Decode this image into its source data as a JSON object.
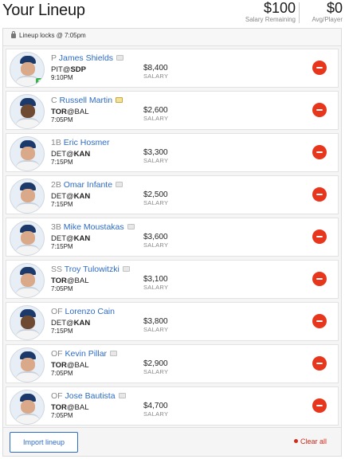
{
  "header": {
    "title": "Your Lineup",
    "salary_remaining": "$100",
    "salary_remaining_label": "Salary Remaining",
    "avg_player": "$0",
    "avg_player_label": "Avg/Player"
  },
  "lock_text": "Lineup locks @ 7:05pm",
  "salary_label": "SALARY",
  "players": [
    {
      "pos": "P",
      "name": "James Shields",
      "team": "PIT",
      "sep": "@",
      "opp": "SDP",
      "bold": "opp",
      "time": "9:10PM",
      "salary": "$8,400",
      "note": "note-icon",
      "probable_badge": "P"
    },
    {
      "pos": "C",
      "name": "Russell Martin",
      "team": "TOR",
      "sep": "@",
      "opp": "BAL",
      "bold": "team",
      "time": "7:05PM",
      "salary": "$2,600",
      "note": "note-active-icon"
    },
    {
      "pos": "1B",
      "name": "Eric Hosmer",
      "team": "DET",
      "sep": "@",
      "opp": "KAN",
      "bold": "opp",
      "time": "7:15PM",
      "salary": "$3,300",
      "note": ""
    },
    {
      "pos": "2B",
      "name": "Omar Infante",
      "team": "DET",
      "sep": "@",
      "opp": "KAN",
      "bold": "opp",
      "time": "7:15PM",
      "salary": "$2,500",
      "note": "note-icon"
    },
    {
      "pos": "3B",
      "name": "Mike Moustakas",
      "team": "DET",
      "sep": "@",
      "opp": "KAN",
      "bold": "opp",
      "time": "7:15PM",
      "salary": "$3,600",
      "note": "note-icon"
    },
    {
      "pos": "SS",
      "name": "Troy Tulowitzki",
      "team": "TOR",
      "sep": "@",
      "opp": "BAL",
      "bold": "team",
      "time": "7:05PM",
      "salary": "$3,100",
      "note": "note-icon"
    },
    {
      "pos": "OF",
      "name": "Lorenzo Cain",
      "team": "DET",
      "sep": "@",
      "opp": "KAN",
      "bold": "opp",
      "time": "7:15PM",
      "salary": "$3,800",
      "note": ""
    },
    {
      "pos": "OF",
      "name": "Kevin Pillar",
      "team": "TOR",
      "sep": "@",
      "opp": "BAL",
      "bold": "team",
      "time": "7:05PM",
      "salary": "$2,900",
      "note": "note-icon"
    },
    {
      "pos": "OF",
      "name": "Jose Bautista",
      "team": "TOR",
      "sep": "@",
      "opp": "BAL",
      "bold": "team",
      "time": "7:05PM",
      "salary": "$4,700",
      "note": "note-icon"
    }
  ],
  "footer": {
    "import_label": "Import lineup",
    "clear_label": "Clear all"
  },
  "colors": {
    "link": "#2d6bc4",
    "remove": "#e8361d",
    "clear": "#d12b1a",
    "probable_badge": "#37b24d"
  }
}
